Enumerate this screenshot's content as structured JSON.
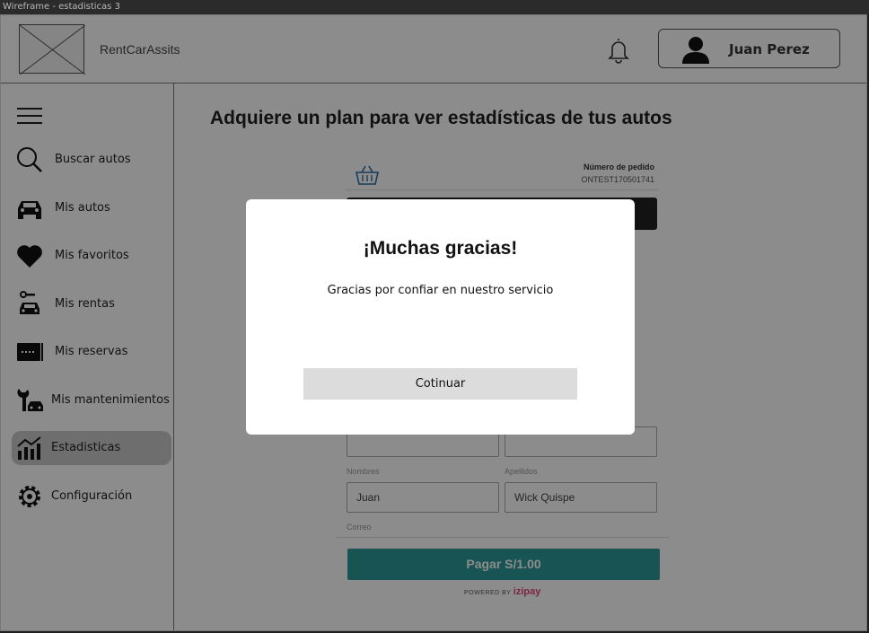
{
  "window": {
    "title": "Wireframe - estadisticas 3"
  },
  "header": {
    "brand": "RentCarAssits",
    "user_name": "Juan Perez"
  },
  "sidebar": {
    "items": [
      {
        "label": "Buscar autos",
        "icon": "search-icon"
      },
      {
        "label": "Mis autos",
        "icon": "car-icon"
      },
      {
        "label": "Mis favoritos",
        "icon": "heart-icon"
      },
      {
        "label": "Mis rentas",
        "icon": "car-key-icon"
      },
      {
        "label": "Mis reservas",
        "icon": "ticket-icon"
      },
      {
        "label": "Mis mantenimientos",
        "icon": "wrench-car-icon"
      },
      {
        "label": "Estadisticas",
        "icon": "chart-icon",
        "active": true
      },
      {
        "label": "Configuración",
        "icon": "gear-icon"
      }
    ]
  },
  "main": {
    "title": "Adquiere un plan para ver estadísticas de tus autos",
    "payment": {
      "order_label": "Número de pedido",
      "order_number": "ONTEST170501741",
      "nombres_label": "Nombres",
      "nombres_value": "Juan",
      "apellidos_label": "Apellidos",
      "apellidos_value": "Wick Quispe",
      "correo_label": "Correo",
      "pay_button": "Pagar S/1.00",
      "powered_by": "POWERED BY",
      "powered_brand": "izipay"
    }
  },
  "modal": {
    "title": "¡Muchas gracias!",
    "message": "Gracias por confiar en nuestro servicio",
    "button": "Cotinuar"
  },
  "colors": {
    "accent": "#2a9a98",
    "active_nav": "#c8c8c8"
  }
}
